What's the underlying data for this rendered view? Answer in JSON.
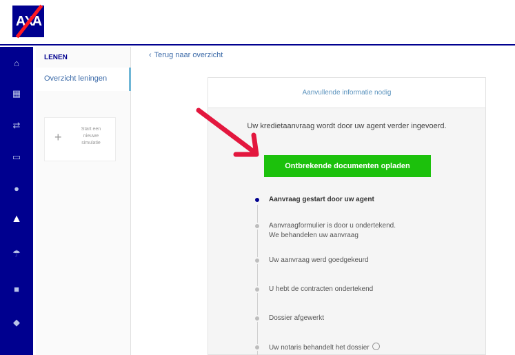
{
  "brand": {
    "name": "AXA"
  },
  "sidebar": {
    "icons": [
      "home-icon",
      "dashboard-icon",
      "transfer-icon",
      "card-icon",
      "savings-icon",
      "loan-icon",
      "insurance-icon",
      "business-icon",
      "pension-icon"
    ],
    "active_index": 5
  },
  "subnav": {
    "section": "LENEN",
    "active_item": "Overzicht leningen",
    "simulation_line1": "Start een",
    "simulation_line2": "nieuwe",
    "simulation_line3": "simulatie"
  },
  "main": {
    "back_link": "Terug naar overzicht",
    "card_header": "Aanvullende informatie nodig",
    "message": "Uw kredietaanvraag wordt door uw agent verder ingevoerd.",
    "upload_button": "Ontbrekende documenten opladen",
    "steps": [
      {
        "line1": "Aanvraag gestart door uw agent",
        "line2": "",
        "current": true
      },
      {
        "line1": "Aanvraagformulier is door u ondertekend.",
        "line2": "We behandelen uw aanvraag",
        "current": false
      },
      {
        "line1": "Uw aanvraag werd goedgekeurd",
        "line2": "",
        "current": false
      },
      {
        "line1": "U hebt de contracten ondertekend",
        "line2": "",
        "current": false
      },
      {
        "line1": "Dossier afgewerkt",
        "line2": "",
        "current": false
      },
      {
        "line1": "Uw notaris behandelt het dossier",
        "line2": "",
        "current": false
      }
    ]
  },
  "colors": {
    "brand": "#00008f",
    "accent_red": "#ff1721",
    "button_green": "#1cc10c",
    "annotation_arrow": "#e3173e"
  }
}
